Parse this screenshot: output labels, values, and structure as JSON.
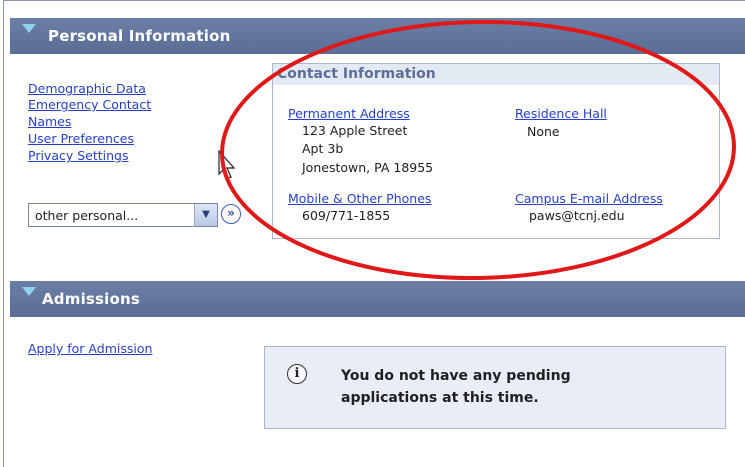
{
  "personal_section": {
    "title": "Personal Information",
    "links": [
      "Demographic Data",
      "Emergency Contact",
      "Names",
      "User Preferences",
      "Privacy Settings"
    ],
    "select": {
      "value": "other personal..."
    },
    "go_icon": "double-chevron-right-icon"
  },
  "contact": {
    "title": "Contact Information",
    "permanent_address": {
      "label": "Permanent Address",
      "line1": "123 Apple Street",
      "line2": "Apt 3b",
      "line3": "Jonestown, PA 18955"
    },
    "residence_hall": {
      "label": "Residence Hall",
      "value": "None"
    },
    "phones": {
      "label": "Mobile & Other Phones",
      "value": "609/771-1855"
    },
    "email": {
      "label": "Campus E-mail Address",
      "value": "paws@tcnj.edu"
    }
  },
  "admissions_section": {
    "title": "Admissions",
    "apply_link": "Apply for Admission",
    "message_line1": "You do not have any pending",
    "message_line2": "applications at this time."
  },
  "colors": {
    "header_bg": "#5a6d95",
    "link": "#2640c8",
    "highlight_ellipse": "#e01818"
  }
}
